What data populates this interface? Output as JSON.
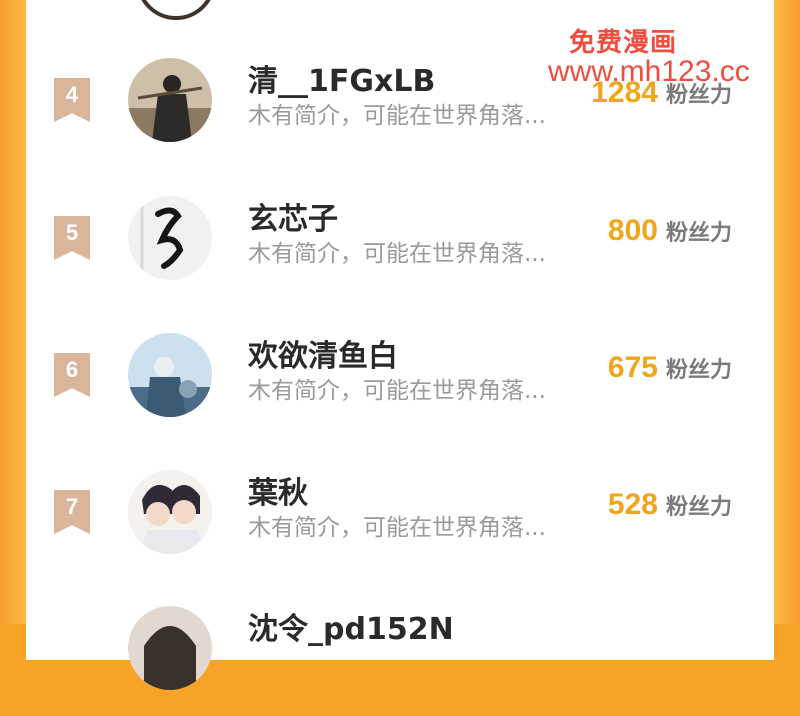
{
  "watermark": {
    "line1": "免费漫画",
    "line2": "www.mh123.cc"
  },
  "rows": [
    {
      "rank": "4",
      "name": "清__1FGxLB",
      "bio": "木有简介，可能在世界角落...",
      "fans": "1284",
      "fans_label": "粉丝力"
    },
    {
      "rank": "5",
      "name": "玄芯子",
      "bio": "木有简介，可能在世界角落...",
      "fans": "800",
      "fans_label": "粉丝力"
    },
    {
      "rank": "6",
      "name": "欢欲清鱼白",
      "bio": "木有简介，可能在世界角落...",
      "fans": "675",
      "fans_label": "粉丝力"
    },
    {
      "rank": "7",
      "name": "葉秋",
      "bio": "木有简介，可能在世界角落...",
      "fans": "528",
      "fans_label": "粉丝力"
    },
    {
      "rank": "",
      "name": "沈令_pd152N",
      "bio": "",
      "fans": "",
      "fans_label": ""
    }
  ]
}
